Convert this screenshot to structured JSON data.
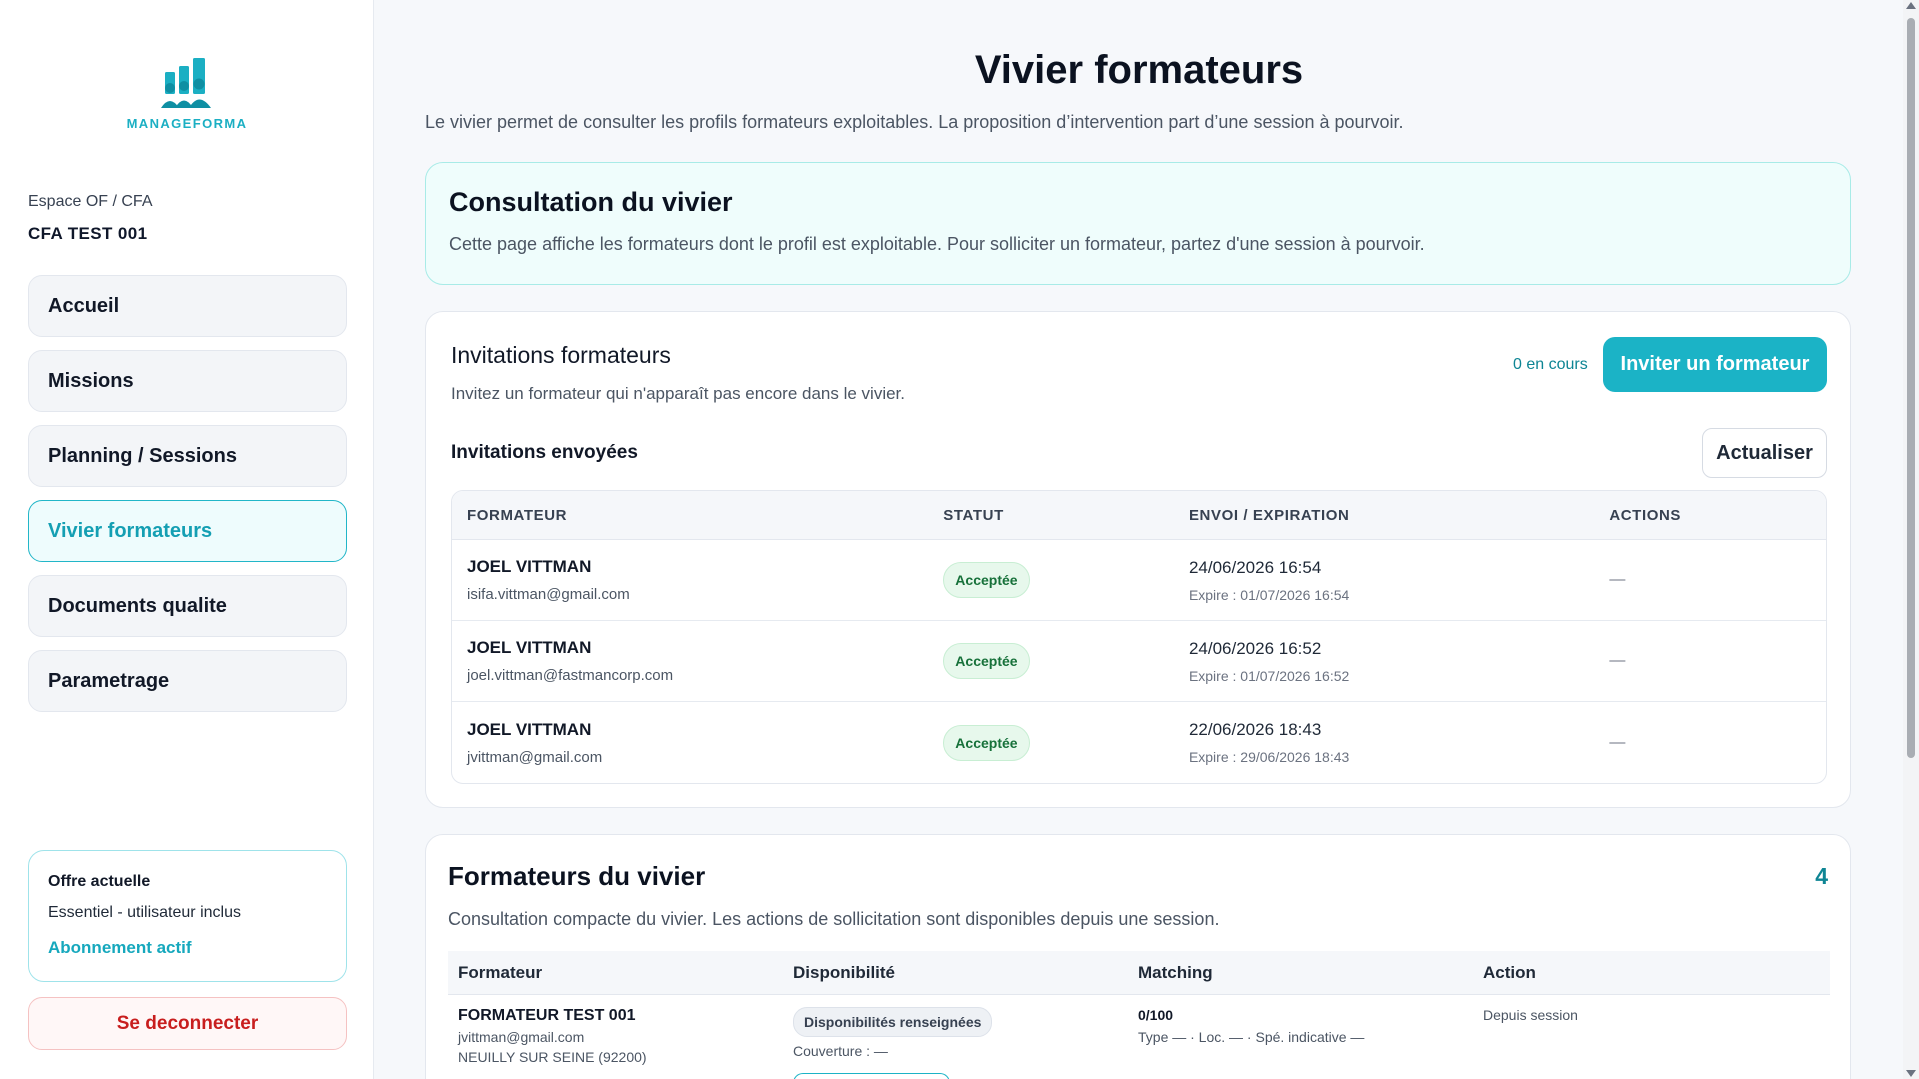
{
  "brand": {
    "name": "MANAGEFORMA",
    "color": "#1bafc3"
  },
  "sidebar": {
    "space_label": "Espace OF / CFA",
    "org_name": "CFA TEST 001",
    "nav": [
      {
        "label": "Accueil",
        "active": false
      },
      {
        "label": "Missions",
        "active": false
      },
      {
        "label": "Planning / Sessions",
        "active": false
      },
      {
        "label": "Vivier formateurs",
        "active": true
      },
      {
        "label": "Documents qualite",
        "active": false
      },
      {
        "label": "Parametrage",
        "active": false
      }
    ],
    "offer": {
      "title": "Offre actuelle",
      "plan": "Essentiel - utilisateur inclus",
      "status": "Abonnement actif"
    },
    "logout_label": "Se deconnecter"
  },
  "page": {
    "title": "Vivier formateurs",
    "subtitle": "Le vivier permet de consulter les profils formateurs exploitables. La proposition d’intervention part d’une session à pourvoir."
  },
  "consultation": {
    "title": "Consultation du vivier",
    "text": "Cette page affiche les formateurs dont le profil est exploitable. Pour solliciter un formateur, partez d'une session à pourvoir."
  },
  "invitations": {
    "title": "Invitations formateurs",
    "subtitle": "Invitez un formateur qui n'apparaît pas encore dans le vivier.",
    "count_label": "0 en cours",
    "invite_button": "Inviter un formateur",
    "sent_title": "Invitations envoyées",
    "refresh_button": "Actualiser",
    "columns": [
      "FORMATEUR",
      "STATUT",
      "ENVOI / EXPIRATION",
      "ACTIONS"
    ],
    "rows": [
      {
        "name": "JOEL VITTMAN",
        "email": "isifa.vittman@gmail.com",
        "status": "Acceptée",
        "sent": "24/06/2026 16:54",
        "expire": "Expire : 01/07/2026 16:54",
        "action": "—"
      },
      {
        "name": "JOEL VITTMAN",
        "email": "joel.vittman@fastmancorp.com",
        "status": "Acceptée",
        "sent": "24/06/2026 16:52",
        "expire": "Expire : 01/07/2026 16:52",
        "action": "—"
      },
      {
        "name": "JOEL VITTMAN",
        "email": "jvittman@gmail.com",
        "status": "Acceptée",
        "sent": "22/06/2026 18:43",
        "expire": "Expire : 29/06/2026 18:43",
        "action": "—"
      }
    ]
  },
  "vivier": {
    "title": "Formateurs du vivier",
    "count": "4",
    "subtitle": "Consultation compacte du vivier. Les actions de sollicitation sont disponibles depuis une session.",
    "columns": [
      "Formateur",
      "Disponibilité",
      "Matching",
      "Action"
    ],
    "rows": [
      {
        "name": "FORMATEUR TEST 001",
        "email": "jvittman@gmail.com",
        "location": "NEUILLY SUR SEINE (92200)",
        "availability": "Disponibilités renseignées",
        "coverage": "Couverture : —",
        "score": "0/100",
        "score_detail": "Type — · Loc. — · Spé. indicative —",
        "action": "Depuis session"
      }
    ]
  },
  "colors": {
    "accent": "#1bb3c6",
    "success": "#17713a",
    "danger": "#c81e1e"
  }
}
